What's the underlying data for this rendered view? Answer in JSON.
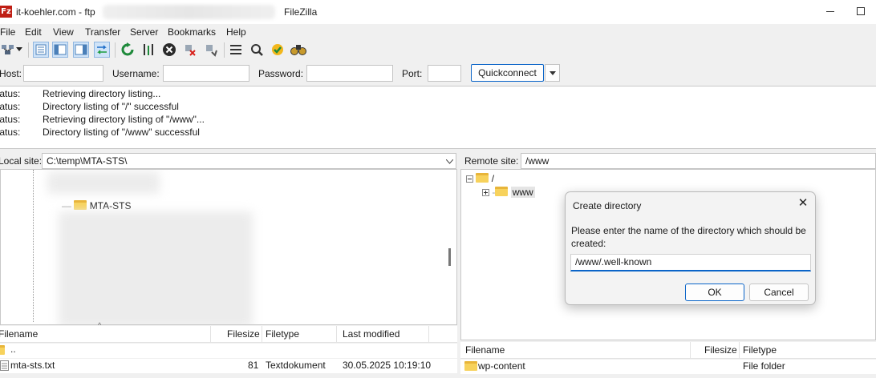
{
  "titlebar": {
    "host": "it-koehler.com - ftp",
    "app_name": "FileZilla",
    "app_icon_text": "Fz"
  },
  "menu": [
    "File",
    "Edit",
    "View",
    "Transfer",
    "Server",
    "Bookmarks",
    "Help"
  ],
  "toolbar_icons": [
    "site-manager-icon",
    "dropdown-arrow-icon",
    "toggle-log-icon",
    "toggle-local-tree-icon",
    "toggle-remote-tree-icon",
    "toggle-queue-icon",
    "refresh-icon",
    "process-queue-icon",
    "cancel-icon",
    "disconnect-icon",
    "reconnect-icon",
    "directory-filter-icon",
    "compare-icon",
    "sync-browse-icon",
    "search-icon"
  ],
  "quickconnect": {
    "host_label": "Host:",
    "host_value": "",
    "username_label": "Username:",
    "username_value": "",
    "password_label": "Password:",
    "password_value": "",
    "port_label": "Port:",
    "port_value": "",
    "button": "Quickconnect"
  },
  "log": [
    {
      "label": "Status:",
      "message": "Retrieving directory listing..."
    },
    {
      "label": "Status:",
      "message": "Directory listing of \"/\" successful"
    },
    {
      "label": "Status:",
      "message": "Retrieving directory listing of \"/www\"..."
    },
    {
      "label": "Status:",
      "message": "Directory listing of \"/www\" successful"
    }
  ],
  "local": {
    "site_label": "Local site:",
    "path": "C:\\temp\\MTA-STS\\",
    "tree_folder": "MTA-STS",
    "columns": [
      "Filename",
      "Filesize",
      "Filetype",
      "Last modified"
    ],
    "files": [
      {
        "name": "..",
        "size": "",
        "type": "",
        "modified": ""
      },
      {
        "name": "mta-sts.txt",
        "size": "81",
        "type": "Textdokument",
        "modified": "30.05.2025 10:19:10"
      }
    ]
  },
  "remote": {
    "site_label": "Remote site:",
    "path": "/www",
    "tree_root": "/",
    "tree_child": "www",
    "columns": [
      "Filename",
      "Filesize",
      "Filetype"
    ],
    "files": [
      {
        "name": "wp-content",
        "size": "",
        "type": "File folder"
      }
    ]
  },
  "dialog": {
    "title": "Create directory",
    "prompt": "Please enter the name of the directory which should be created:",
    "input_value": "/www/.well-known",
    "ok": "OK",
    "cancel": "Cancel"
  }
}
